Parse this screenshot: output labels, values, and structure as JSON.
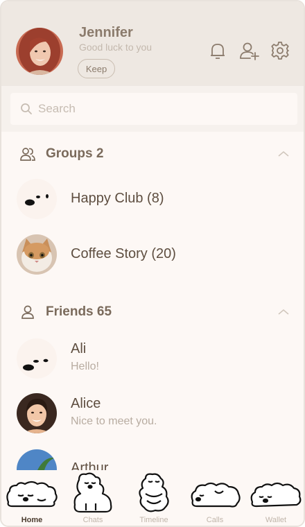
{
  "profile": {
    "name": "Jennifer",
    "status": "Good luck to you",
    "keep_label": "Keep"
  },
  "header_icons": [
    "bell-icon",
    "add-friend-icon",
    "gear-icon"
  ],
  "search": {
    "placeholder": "Search"
  },
  "groups": {
    "title": "Groups 2",
    "items": [
      {
        "name": "Happy Club (8)"
      },
      {
        "name": "Coffee Story (20)"
      }
    ]
  },
  "friends": {
    "title": "Friends 65",
    "items": [
      {
        "name": "Ali",
        "status": "Hello!"
      },
      {
        "name": "Alice",
        "status": "Nice to meet you."
      },
      {
        "name": "Arthur",
        "status": ""
      }
    ]
  },
  "tabs": [
    {
      "label": "Home",
      "active": true
    },
    {
      "label": "Chats",
      "active": false
    },
    {
      "label": "Timeline",
      "active": false
    },
    {
      "label": "Calls",
      "active": false
    },
    {
      "label": "Wallet",
      "active": false
    }
  ],
  "colors": {
    "header_bg": "#eee8e2",
    "page_bg": "#fdf8f5",
    "text_primary": "#5e4e40",
    "text_muted": "#b8aca1"
  }
}
